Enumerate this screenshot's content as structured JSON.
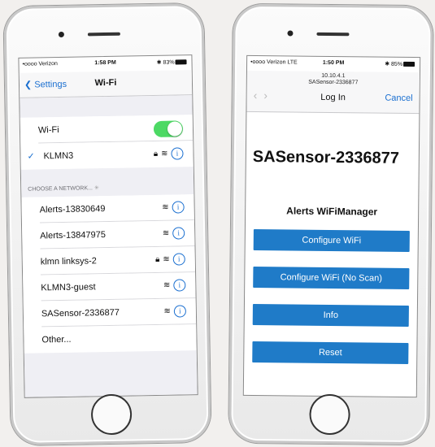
{
  "left_phone": {
    "status": {
      "carrier": "•oooo Verizon",
      "time": "1:58 PM",
      "battery": "83%"
    },
    "nav": {
      "back_label": "Settings",
      "title": "Wi-Fi"
    },
    "wifi_row": {
      "label": "Wi-Fi",
      "enabled": true
    },
    "connected_network": "KLMN3",
    "section_header": "CHOOSE A NETWORK...",
    "networks": [
      {
        "name": "Alerts-13830649",
        "locked": false
      },
      {
        "name": "Alerts-13847975",
        "locked": false
      },
      {
        "name": "klmn linksys-2",
        "locked": true
      },
      {
        "name": "KLMN3-guest",
        "locked": false
      },
      {
        "name": "SASensor-2336877",
        "locked": false
      }
    ],
    "other_label": "Other..."
  },
  "right_phone": {
    "status": {
      "carrier": "•oooo Verizon LTE",
      "time": "1:50 PM",
      "battery": "85%"
    },
    "address": "10.10.4.1",
    "ssid": "SASensor-2336877",
    "header_title": "Log In",
    "cancel_label": "Cancel",
    "page_title": "SASensor-2336877",
    "page_subtitle": "Alerts WiFiManager",
    "buttons": [
      "Configure WiFi",
      "Configure WiFi (No Scan)",
      "Info",
      "Reset"
    ]
  },
  "colors": {
    "accent": "#1a6fd0",
    "toggle_on": "#4cd964",
    "button": "#1f7bc8"
  }
}
